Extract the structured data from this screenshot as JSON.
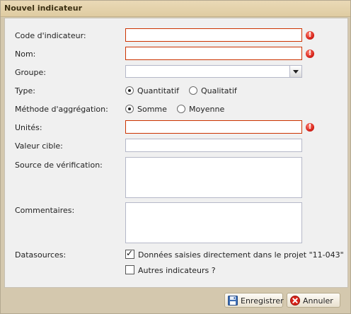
{
  "window": {
    "title": "Nouvel indicateur"
  },
  "form": {
    "code": {
      "label": "Code d'indicateur:",
      "value": ""
    },
    "nom": {
      "label": "Nom:",
      "value": ""
    },
    "groupe": {
      "label": "Groupe:",
      "value": ""
    },
    "type": {
      "label": "Type:",
      "options": [
        "Quantitatif",
        "Qualitatif"
      ],
      "selected": "Quantitatif"
    },
    "aggregation": {
      "label": "Méthode d'aggrégation:",
      "options": [
        "Somme",
        "Moyenne"
      ],
      "selected": "Somme"
    },
    "unites": {
      "label": "Unités:",
      "value": ""
    },
    "valeur_cible": {
      "label": "Valeur cible:",
      "value": ""
    },
    "source": {
      "label": "Source de vérification:",
      "value": ""
    },
    "commentaires": {
      "label": "Commentaires:",
      "value": ""
    },
    "datasources": {
      "label": "Datasources:",
      "items": [
        {
          "label": "Données saisies directement dans le projet \"11-043\"",
          "checked": true
        },
        {
          "label": "Autres indicateurs ?",
          "checked": false
        }
      ]
    }
  },
  "buttons": {
    "save": "Enregistrer",
    "cancel": "Annuler"
  },
  "icons": {
    "error": "error-icon",
    "save": "floppy-disk-icon",
    "cancel": "cancel-icon"
  },
  "colors": {
    "error": "#d8231a",
    "title_text": "#3b2f12",
    "field_border": "#b5b8c8"
  }
}
